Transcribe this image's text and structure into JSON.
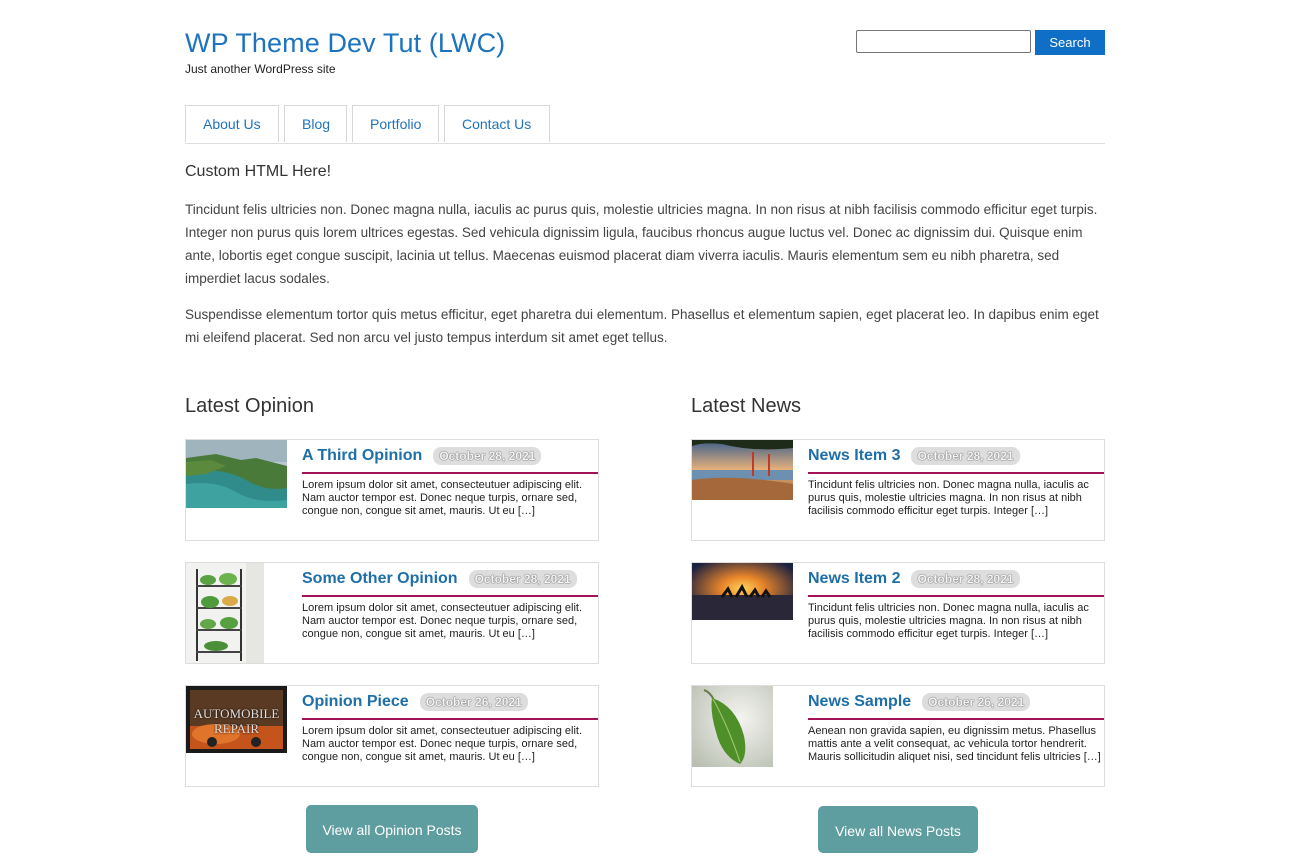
{
  "site": {
    "title": "WP Theme Dev Tut (LWC)",
    "tagline": "Just another WordPress site"
  },
  "search": {
    "value": "",
    "placeholder": "",
    "button_label": "Search"
  },
  "nav": {
    "items": [
      {
        "label": "About Us"
      },
      {
        "label": "Blog"
      },
      {
        "label": "Portfolio"
      },
      {
        "label": "Contact Us"
      }
    ]
  },
  "intro": {
    "heading": "Custom HTML Here!",
    "paragraphs": [
      "Tincidunt felis ultricies non. Donec magna nulla, iaculis ac purus quis, molestie ultricies magna. In non risus at nibh facilisis commodo efficitur eget turpis. Integer non purus quis lorem ultrices egestas. Sed vehicula dignissim ligula, faucibus rhoncus augue luctus vel. Donec ac dignissim dui. Quisque enim ante, lobortis eget congue suscipit, lacinia ut tellus. Maecenas euismod placerat diam viverra iaculis. Mauris elementum sem eu nibh pharetra, sed imperdiet lacus sodales.",
      "Suspendisse elementum tortor quis metus efficitur, eget pharetra dui elementum. Phasellus et elementum sapien, eget placerat leo. In dapibus enim eget mi eleifend placerat. Sed non arcu vel justo tempus interdum sit amet eget tellus."
    ]
  },
  "opinion": {
    "heading": "Latest Opinion",
    "posts": [
      {
        "title": "A Third Opinion",
        "date": "October 28, 2021",
        "excerpt": "Lorem ipsum dolor sit amet, consecteutuer adipiscing elit. Nam auctor tempor est. Donec neque turpis, ornare sed, congue non, congue sit amet, mauris. Ut eu […]",
        "image": "cliffs-coast-thumbnail"
      },
      {
        "title": "Some Other Opinion",
        "date": "October 28, 2021",
        "excerpt": "Lorem ipsum dolor sit amet, consecteutuer adipiscing elit. Nam auctor tempor est. Donec neque turpis, ornare sed, congue non, congue sit amet, mauris. Ut eu […]",
        "image": "plant-shelf-thumbnail"
      },
      {
        "title": "Opinion Piece",
        "date": "October 26, 2021",
        "excerpt": "Lorem ipsum dolor sit amet, consecteutuer adipiscing elit. Nam auctor tempor est. Donec neque turpis, ornare sed, congue non, congue sit amet, mauris. Ut eu […]",
        "image": "automobile-repair-thumbnail",
        "image_text": "AUTOMOBILE REPAIR"
      }
    ],
    "view_all_label": "View all Opinion Posts"
  },
  "news": {
    "heading": "Latest News",
    "posts": [
      {
        "title": "News Item 3",
        "date": "October 28, 2021",
        "excerpt": "Tincidunt felis ultricies non. Donec magna nulla, iaculis ac purus quis, molestie ultricies magna. In non risus at nibh facilisis commodo efficitur eget turpis. Integer […]",
        "image": "golden-gate-thumbnail"
      },
      {
        "title": "News Item 2",
        "date": "October 28, 2021",
        "excerpt": "Tincidunt felis ultricies non. Donec magna nulla, iaculis ac purus quis, molestie ultricies magna. In non risus at nibh facilisis commodo efficitur eget turpis. Integer […]",
        "image": "sunset-camels-thumbnail"
      },
      {
        "title": "News Sample",
        "date": "October 26, 2021",
        "excerpt": "Aenean non gravida sapien, eu dignissim metus. Phasellus mattis ante a velit consequat, ac vehicula tortor hendrerit. Mauris sollicitudin aliquet nisi, sed tincidunt felis ultricies […]",
        "image": "green-leaf-thumbnail"
      }
    ],
    "view_all_label": "View all News Posts"
  },
  "colors": {
    "link": "#1e73be",
    "search_button": "#0f6fc6",
    "accent_rule": "#a4135a",
    "view_all_button": "#5f9ea0"
  }
}
